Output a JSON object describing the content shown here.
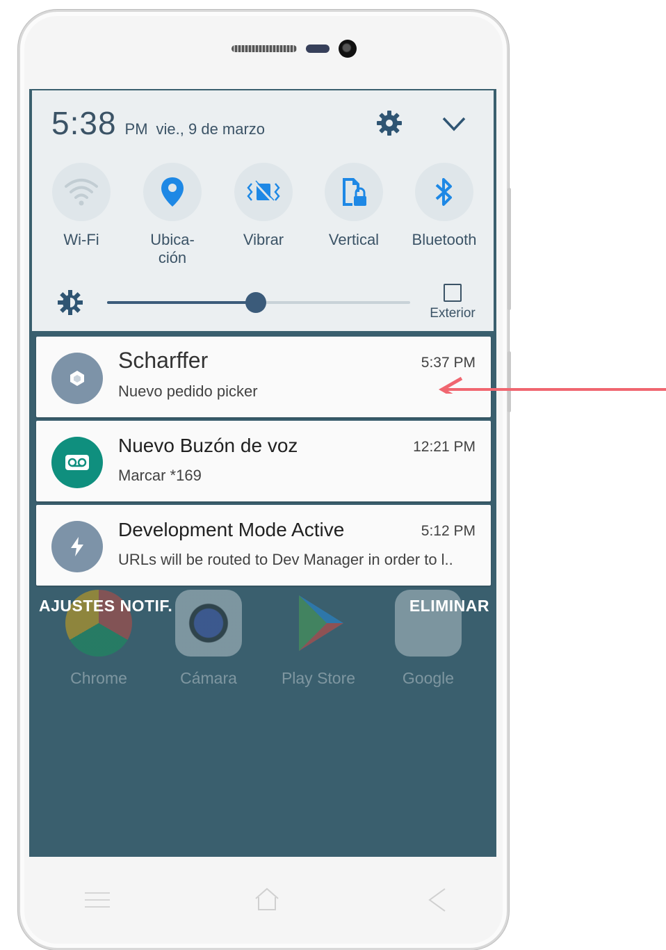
{
  "status": {
    "time": "5:38",
    "ampm": "PM",
    "date": "vie., 9 de marzo"
  },
  "quick_settings": {
    "tiles": [
      {
        "label": "Wi-Fi",
        "icon": "wifi-icon"
      },
      {
        "label": "Ubica-\nción",
        "icon": "location-icon"
      },
      {
        "label": "Vibrar",
        "icon": "vibrate-icon"
      },
      {
        "label": "Vertical",
        "icon": "rotation-lock-icon"
      },
      {
        "label": "Bluetooth",
        "icon": "bluetooth-icon"
      }
    ],
    "brightness_level": 0.49,
    "auto_label": "Exterior"
  },
  "notifications": [
    {
      "title": "Scharffer",
      "time": "5:37 PM",
      "text": "Nuevo pedido picker",
      "icon_color": "#7d93a8"
    },
    {
      "title": "Nuevo Buzón de voz",
      "time": "12:21 PM",
      "text": "Marcar *169",
      "icon_color": "#0f8f7e"
    },
    {
      "title": "Development Mode Active",
      "time": "5:12 PM",
      "text": "URLs will be routed to Dev Manager in order to l..",
      "icon_color": "#7d93a8"
    }
  ],
  "actions": {
    "settings": "AJUSTES NOTIF.",
    "clear": "ELIMINAR"
  },
  "home_apps": [
    {
      "label": "Chrome"
    },
    {
      "label": "Cámara"
    },
    {
      "label": "Play Store"
    },
    {
      "label": "Google"
    }
  ],
  "colors": {
    "accent": "#3b5b7a",
    "screen_bg": "#3a5f6e",
    "arrow": "#f06670",
    "panel_bg": "#ebeff1"
  }
}
